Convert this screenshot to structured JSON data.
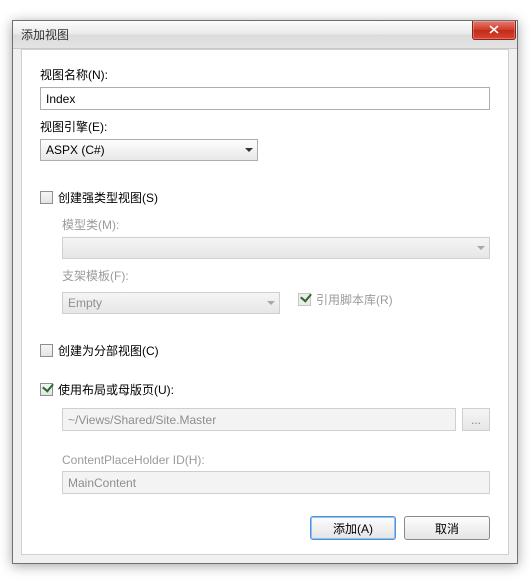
{
  "window": {
    "title": "添加视图"
  },
  "viewName": {
    "label": "视图名称(N):",
    "value": "Index"
  },
  "viewEngine": {
    "label": "视图引擎(E):",
    "selected": "ASPX (C#)"
  },
  "strongType": {
    "checked": false,
    "label": "创建强类型视图(S)",
    "modelClass": {
      "label": "模型类(M):",
      "selected": ""
    },
    "scaffold": {
      "label": "支架模板(F):",
      "selected": "Empty"
    },
    "refScripts": {
      "checked": true,
      "label": "引用脚本库(R)"
    }
  },
  "partial": {
    "checked": false,
    "label": "创建为分部视图(C)"
  },
  "useLayout": {
    "checked": true,
    "label": "使用布局或母版页(U):",
    "path": "~/Views/Shared/Site.Master",
    "browse": "...",
    "cph": {
      "label": "ContentPlaceHolder ID(H):",
      "value": "MainContent"
    }
  },
  "buttons": {
    "add": "添加(A)",
    "cancel": "取消"
  }
}
